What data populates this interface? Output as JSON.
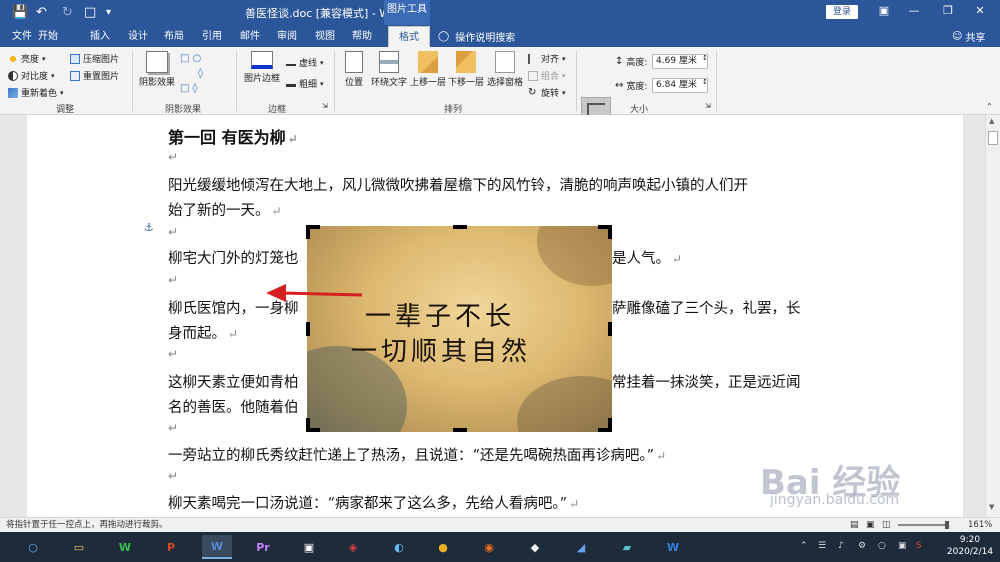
{
  "titlebar": {
    "title": "善医怪谈.doc [兼容模式] - Word",
    "context_group": "图片工具",
    "login": "登录"
  },
  "tabs": [
    "文件",
    "开始",
    "插入",
    "设计",
    "布局",
    "引用",
    "邮件",
    "审阅",
    "视图",
    "帮助",
    "格式"
  ],
  "active_tab": "格式",
  "tellme": "操作说明搜索",
  "share": "共享",
  "ribbon": {
    "adjust": {
      "brightness": "亮度",
      "contrast": "对比度",
      "recolor": "重新着色",
      "compress": "压缩图片",
      "reset": "重置图片",
      "label": "调整"
    },
    "shadow": {
      "button": "阴影效果",
      "label": "阴影效果"
    },
    "border": {
      "button": "图片边框",
      "dash": "虚线",
      "weight": "粗细",
      "label": "边框"
    },
    "arrange": {
      "position": "位置",
      "wrap": "环绕文字",
      "forward": "上移一层",
      "backward": "下移一层",
      "selection": "选择窗格",
      "align": "对齐",
      "group": "组合",
      "rotate": "旋转",
      "label": "排列"
    },
    "size": {
      "crop": "裁剪",
      "height_label": "高度:",
      "height_value": "4.69 厘米",
      "width_label": "宽度:",
      "width_value": "6.84 厘米",
      "label": "大小"
    }
  },
  "document": {
    "heading": "第一回  有医为柳",
    "p1a": "阳光缓缓地倾泻在大地上，风儿微微吹拂着屋檐下的风竹铃，清脆的响声唤起小镇的人们开",
    "p1b": "始了新的一天。",
    "p2a": "柳宅大门外的灯笼也",
    "p2b": "是人气。",
    "p3a": "柳氏医馆内，一身柳",
    "p3b": "萨雕像磕了三个头，礼罢，长",
    "p3c": "身而起。",
    "p4a": "这柳天素立便如青柏",
    "p4b": "常挂着一抹淡笑，正是远近闻",
    "p4c": "名的善医。他随着伯",
    "p5": "一旁站立的柳氏秀纹赶忙递上了热汤，且说道：“还是先喝碗热面再诊病吧。”",
    "p6": "柳天素喝完一口汤说道：“病家都来了这么多，先给人看病吧。”",
    "para_mark": "↵"
  },
  "image_text": {
    "line1": "一辈子不长",
    "line2": "一切顺其自然"
  },
  "statusbar": {
    "hint": "将指针置于任一控点上，再拖动进行裁剪。",
    "zoom": "161%"
  },
  "taskbar": {
    "apps": [
      "○",
      "▭",
      "W",
      "P",
      "W",
      "Pr",
      "▣",
      "◈",
      "◐",
      "●",
      "◉",
      "◆",
      "◢",
      "▰",
      "W"
    ],
    "time": "9:20",
    "date": "2020/2/14"
  },
  "watermark": {
    "text": "Bai  经验",
    "sub": "jingyan.baidu.com"
  }
}
